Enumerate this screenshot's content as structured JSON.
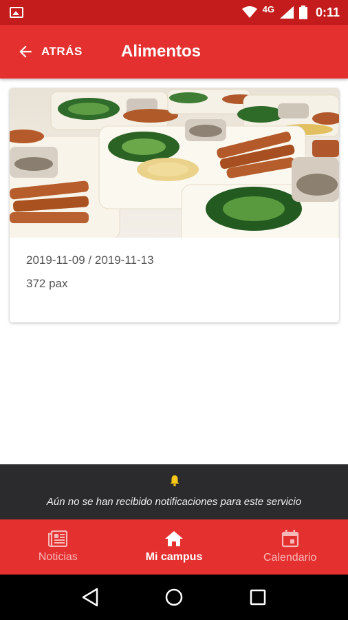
{
  "status_bar": {
    "network": "4G",
    "time": "0:11",
    "icons": [
      "image-icon",
      "wifi-icon",
      "signal-icon",
      "battery-icon"
    ]
  },
  "app_bar": {
    "back_label": "ATRÁS",
    "title": "Alimentos",
    "color": "#e53030"
  },
  "card": {
    "image_alt": "food-trays-photo",
    "dates": "2019-11-09 / 2019-11-13",
    "pax": "372 pax"
  },
  "notification": {
    "icon": "bell-icon",
    "text": "Aún no se han recibido notificaciones para este servicio"
  },
  "bottom_nav": {
    "items": [
      {
        "label": "Noticias",
        "icon": "news-icon",
        "active": false
      },
      {
        "label": "Mi campus",
        "icon": "home-icon",
        "active": true
      },
      {
        "label": "Calendario",
        "icon": "calendar-icon",
        "active": false
      }
    ]
  },
  "system_nav": {
    "buttons": [
      "back-triangle-icon",
      "home-circle-icon",
      "recents-square-icon"
    ]
  }
}
